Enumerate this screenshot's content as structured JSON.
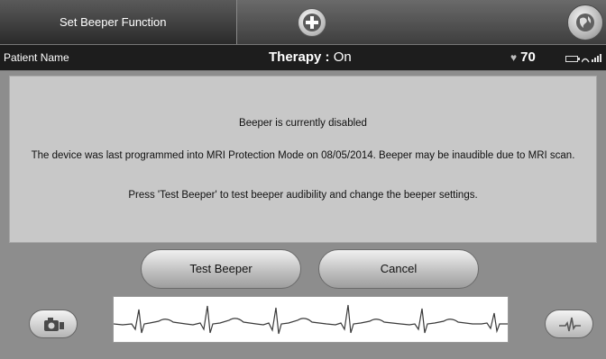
{
  "header": {
    "title": "Set Beeper Function",
    "add_icon": "plus-icon",
    "menu_icon": "globe-icon"
  },
  "status": {
    "patient_label": "Patient Name",
    "therapy_label": "Therapy :",
    "therapy_value": "On",
    "heart_icon": "heart-icon",
    "heart_rate": "70"
  },
  "message": {
    "line1": "Beeper is currently disabled",
    "line2": "The device was last programmed into MRI Protection Mode on 08/05/2014. Beeper may be inaudible due to MRI scan.",
    "line3": "Press 'Test Beeper' to test beeper audibility and change the beeper settings."
  },
  "buttons": {
    "test_beeper": "Test Beeper",
    "cancel": "Cancel"
  },
  "footer": {
    "snapshot_icon": "camera-icon",
    "pulse_icon": "ecg-pulse-icon"
  },
  "colors": {
    "panel": "#c8c8c8",
    "background": "#8d8d8d",
    "statusbar": "#1d1d1d"
  }
}
